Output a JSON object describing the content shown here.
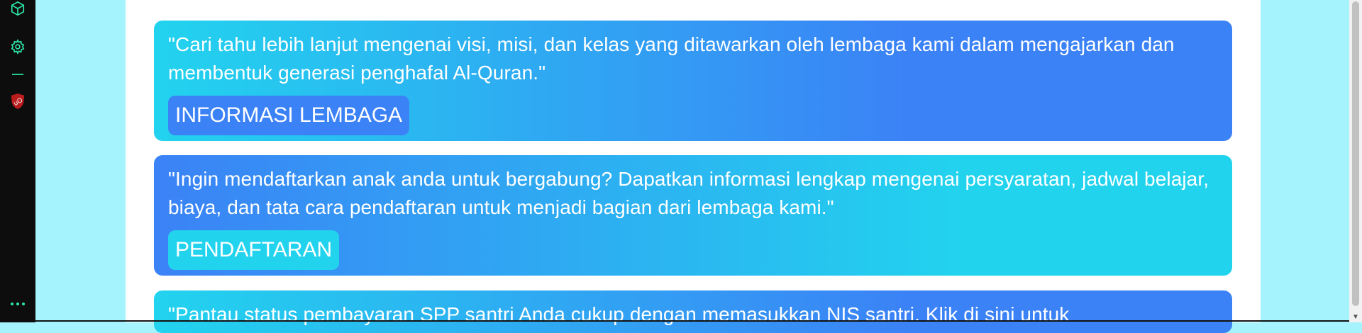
{
  "sidebar": {
    "icons": [
      "cube-icon",
      "gear-icon",
      "minus-icon",
      "shield-icon",
      "more-icon"
    ]
  },
  "cards": [
    {
      "text": "\"Cari tahu lebih lanjut mengenai visi, misi, dan kelas yang ditawarkan oleh lembaga kami dalam mengajarkan dan membentuk generasi penghafal Al-Quran.\"",
      "button": "INFORMASI LEMBAGA"
    },
    {
      "text": "\"Ingin mendaftarkan anak anda untuk bergabung? Dapatkan informasi lengkap mengenai persyaratan, jadwal belajar, biaya, dan tata cara pendaftaran untuk menjadi bagian dari lembaga kami.\"",
      "button": "PENDAFTARAN"
    },
    {
      "text": "\"Pantau status pembayaran SPP santri Anda cukup dengan memasukkan NIS santri. Klik di sini untuk"
    }
  ],
  "colors": {
    "background": "#a5f3fc",
    "blue": "#3b82f6",
    "cyan": "#22d3ee"
  }
}
